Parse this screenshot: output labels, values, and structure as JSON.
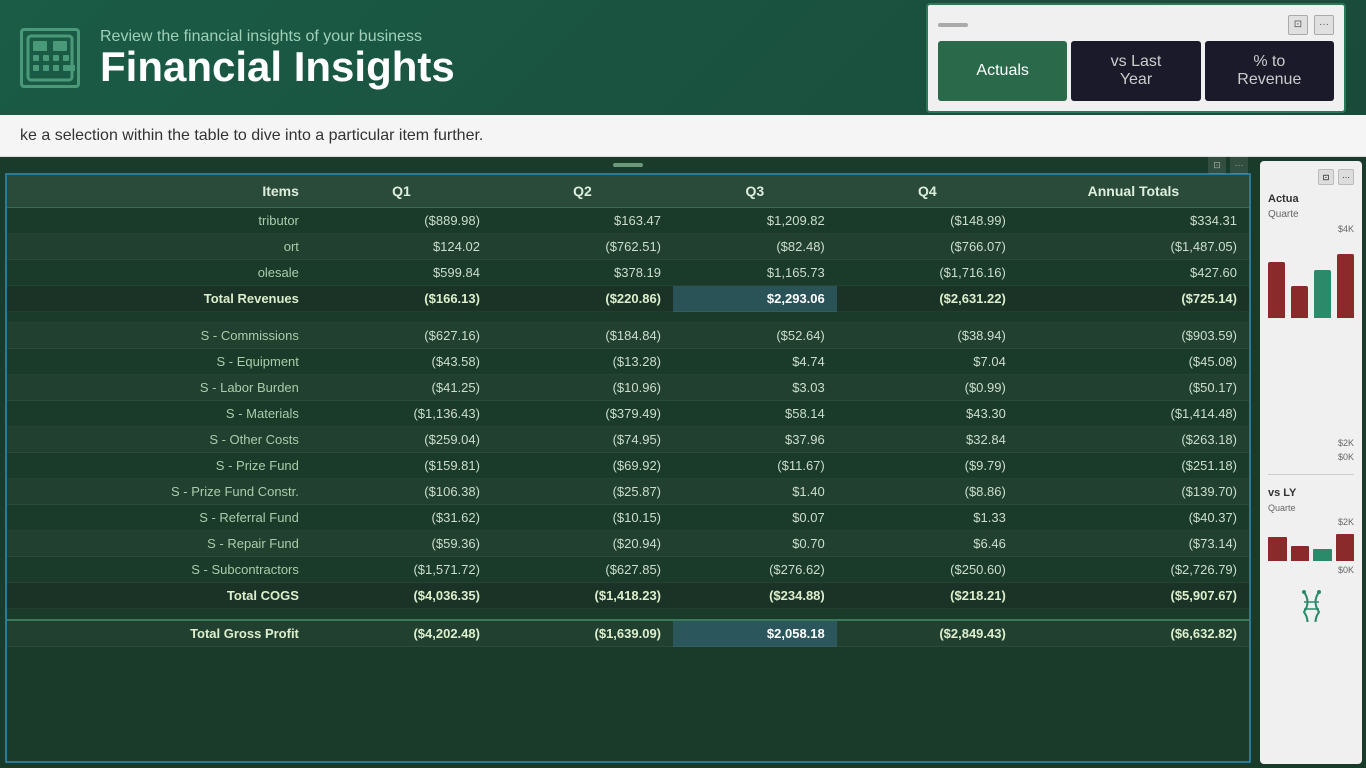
{
  "header": {
    "subtitle": "Review the financial insights of your business",
    "title": "Financial Insights",
    "logo_aria": "financial-calculator-logo"
  },
  "tabs": {
    "actuals": "Actuals",
    "vs_last_year": "vs Last Year",
    "pct_to_revenue": "% to Revenue"
  },
  "subtitle_bar": {
    "text": "ke a selection within the table to dive into a particular item further."
  },
  "table": {
    "columns": {
      "items": "Items",
      "q1": "Q1",
      "q2": "Q2",
      "q3": "Q3",
      "q4": "Q4",
      "annual": "Annual Totals"
    },
    "rows": [
      {
        "item": "tributor",
        "q1": "($889.98)",
        "q2": "$163.47",
        "q3": "$1,209.82",
        "q4": "($148.99)",
        "annual": "$334.31",
        "type": "normal"
      },
      {
        "item": "ort",
        "q1": "$124.02",
        "q2": "($762.51)",
        "q3": "($82.48)",
        "q4": "($766.07)",
        "annual": "($1,487.05)",
        "type": "normal"
      },
      {
        "item": "olesale",
        "q1": "$599.84",
        "q2": "$378.19",
        "q3": "$1,165.73",
        "q4": "($1,716.16)",
        "annual": "$427.60",
        "type": "normal"
      },
      {
        "item": "    Total Revenues",
        "q1": "($166.13)",
        "q2": "($220.86)",
        "q3": "$2,293.06",
        "q4": "($2,631.22)",
        "annual": "($725.14)",
        "type": "total"
      },
      {
        "item": "",
        "q1": "",
        "q2": "",
        "q3": "",
        "q4": "",
        "annual": "",
        "type": "spacer"
      },
      {
        "item": "S - Commissions",
        "q1": "($627.16)",
        "q2": "($184.84)",
        "q3": "($52.64)",
        "q4": "($38.94)",
        "annual": "($903.59)",
        "type": "normal"
      },
      {
        "item": "S - Equipment",
        "q1": "($43.58)",
        "q2": "($13.28)",
        "q3": "$4.74",
        "q4": "$7.04",
        "annual": "($45.08)",
        "type": "normal"
      },
      {
        "item": "S - Labor Burden",
        "q1": "($41.25)",
        "q2": "($10.96)",
        "q3": "$3.03",
        "q4": "($0.99)",
        "annual": "($50.17)",
        "type": "normal"
      },
      {
        "item": "S - Materials",
        "q1": "($1,136.43)",
        "q2": "($379.49)",
        "q3": "$58.14",
        "q4": "$43.30",
        "annual": "($1,414.48)",
        "type": "normal"
      },
      {
        "item": "S - Other Costs",
        "q1": "($259.04)",
        "q2": "($74.95)",
        "q3": "$37.96",
        "q4": "$32.84",
        "annual": "($263.18)",
        "type": "normal"
      },
      {
        "item": "S - Prize Fund",
        "q1": "($159.81)",
        "q2": "($69.92)",
        "q3": "($11.67)",
        "q4": "($9.79)",
        "annual": "($251.18)",
        "type": "normal"
      },
      {
        "item": "S - Prize Fund Constr.",
        "q1": "($106.38)",
        "q2": "($25.87)",
        "q3": "$1.40",
        "q4": "($8.86)",
        "annual": "($139.70)",
        "type": "normal"
      },
      {
        "item": "S - Referral Fund",
        "q1": "($31.62)",
        "q2": "($10.15)",
        "q3": "$0.07",
        "q4": "$1.33",
        "annual": "($40.37)",
        "type": "normal"
      },
      {
        "item": "S - Repair Fund",
        "q1": "($59.36)",
        "q2": "($20.94)",
        "q3": "$0.70",
        "q4": "$6.46",
        "annual": "($73.14)",
        "type": "normal"
      },
      {
        "item": "S - Subcontractors",
        "q1": "($1,571.72)",
        "q2": "($627.85)",
        "q3": "($276.62)",
        "q4": "($250.60)",
        "annual": "($2,726.79)",
        "type": "normal"
      },
      {
        "item": "    Total COGS",
        "q1": "($4,036.35)",
        "q2": "($1,418.23)",
        "q3": "($234.88)",
        "q4": "($218.21)",
        "annual": "($5,907.67)",
        "type": "total"
      },
      {
        "item": "",
        "q1": "",
        "q2": "",
        "q3": "",
        "q4": "",
        "annual": "",
        "type": "spacer"
      },
      {
        "item": "Total Gross Profit",
        "q1": "($4,202.48)",
        "q2": "($1,639.09)",
        "q3": "$2,058.18",
        "q4": "($2,849.43)",
        "annual": "($6,632.82)",
        "type": "gross-profit"
      }
    ]
  },
  "right_panel": {
    "actuals_label": "Actua",
    "quarter_label": "Quarte",
    "bar_value": "$4K",
    "bar_value2": "$2K",
    "bar_value3": "$0K",
    "vs_label": "vs LY",
    "vs_quarter": "Quarte",
    "vs_bar_value": "$2K",
    "vs_bar_value2": "$0K"
  },
  "controls": {
    "expand_icon": "⊡",
    "more_icon": "···",
    "drag_icon": "≡"
  }
}
